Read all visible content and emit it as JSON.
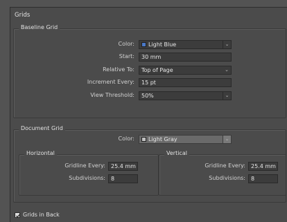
{
  "dialog": {
    "title": "Grids"
  },
  "baseline": {
    "heading": "Baseline Grid",
    "color_label": "Color:",
    "color_value": "Light Blue",
    "color_swatch": "#4a79c8",
    "start_label": "Start:",
    "start_value": "30 mm",
    "relative_label": "Relative To:",
    "relative_value": "Top of Page",
    "increment_label": "Increment Every:",
    "increment_value": "15 pt",
    "threshold_label": "View Threshold:",
    "threshold_value": "50%"
  },
  "document": {
    "heading": "Document Grid",
    "color_label": "Color:",
    "color_value": "Light Gray",
    "color_swatch": "#bfbfbf",
    "horizontal": {
      "heading": "Horizontal",
      "gridline_label": "Gridline Every:",
      "gridline_value": "25.4 mm",
      "subdivisions_label": "Subdivisions:",
      "subdivisions_value": "8"
    },
    "vertical": {
      "heading": "Vertical",
      "gridline_label": "Gridline Every:",
      "gridline_value": "25.4 mm",
      "subdivisions_label": "Subdivisions:",
      "subdivisions_value": "8"
    }
  },
  "grids_in_back": {
    "label": "Grids in Back",
    "checked": true
  }
}
